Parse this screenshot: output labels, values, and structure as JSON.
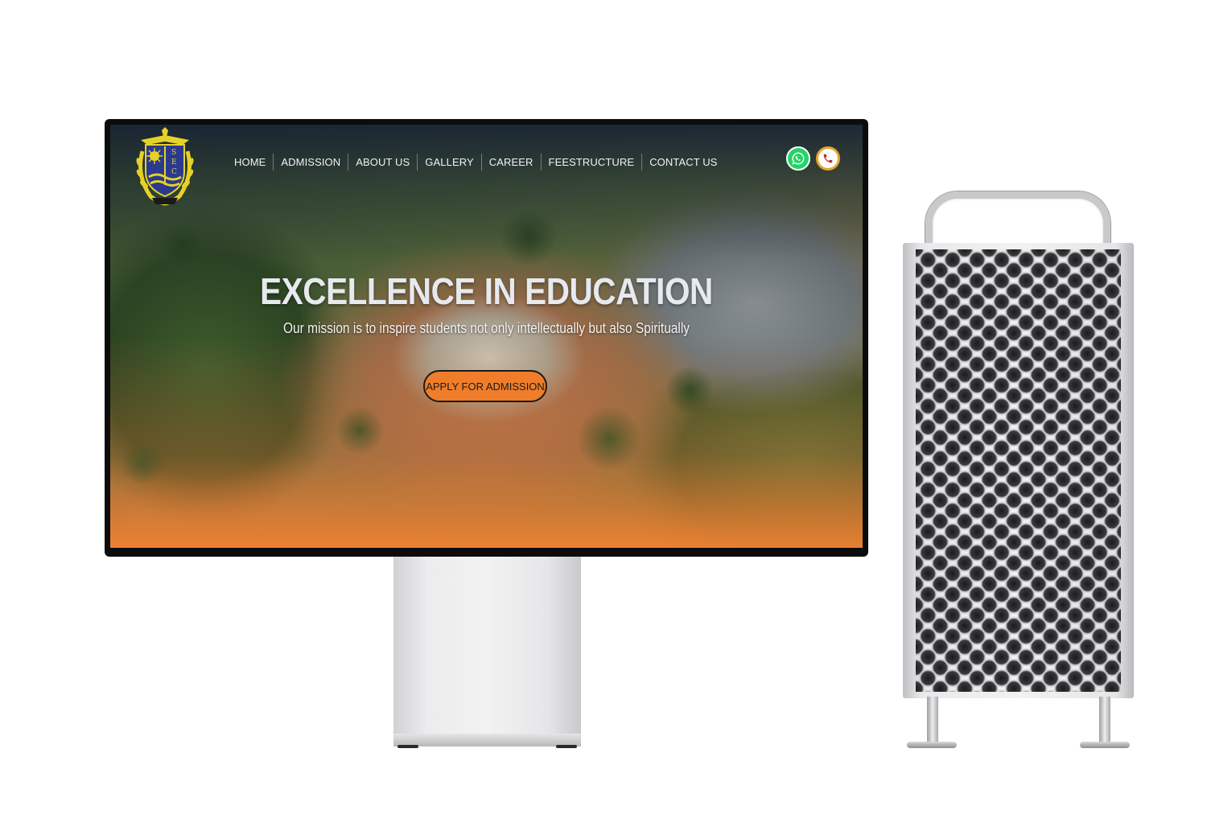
{
  "site": {
    "logo_letters": "SEC",
    "nav": [
      {
        "label": "HOME"
      },
      {
        "label": "ADMISSION"
      },
      {
        "label": "ABOUT US"
      },
      {
        "label": "GALLERY"
      },
      {
        "label": "CAREER"
      },
      {
        "label": "FEESTRUCTURE"
      },
      {
        "label": "CONTACT US"
      }
    ],
    "icons": {
      "whatsapp": "whatsapp-icon",
      "phone": "phone-icon"
    },
    "hero": {
      "title": "EXCELLENCE IN EDUCATION",
      "subtitle": "Our mission is to inspire students not only intellectually but also Spiritually",
      "cta_label": "APPLY FOR ADMISSION"
    }
  },
  "colors": {
    "accent": "#f07d2a",
    "logo_blue": "#2b3a8f",
    "logo_gold": "#e6d128",
    "whatsapp_green": "#25d366"
  }
}
